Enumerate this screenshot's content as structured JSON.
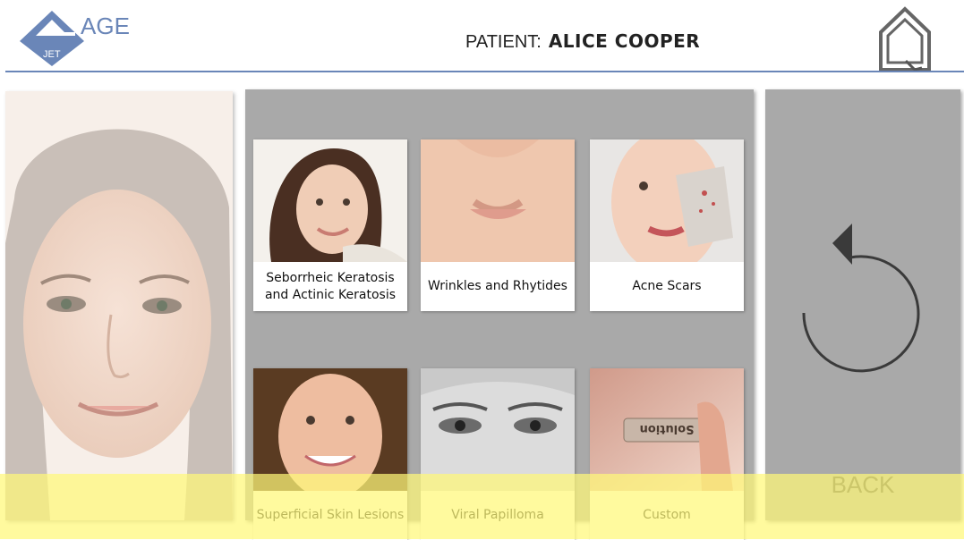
{
  "header": {
    "logo_text_top": "AGE",
    "logo_text_bottom": "JET",
    "patient_label": "PATIENT:",
    "patient_name": "ALICE COOPER",
    "home_icon": "home-icon"
  },
  "tiles": [
    {
      "label": "Seborrheic Keratosis and Actinic Keratosis"
    },
    {
      "label": "Wrinkles and Rhytides"
    },
    {
      "label": "Acne Scars"
    },
    {
      "label": "Superficial Skin Lesions"
    },
    {
      "label": "Viral Papilloma"
    },
    {
      "label": "Custom",
      "image_text": "Solution"
    }
  ],
  "back": {
    "label": "BACK",
    "icon": "back-arrow-icon"
  },
  "colors": {
    "header_line": "#6a86b8",
    "logo_blue": "#6a86b8",
    "panel_gray": "#a9a9a9",
    "overlay_yellow": "#fff878"
  }
}
